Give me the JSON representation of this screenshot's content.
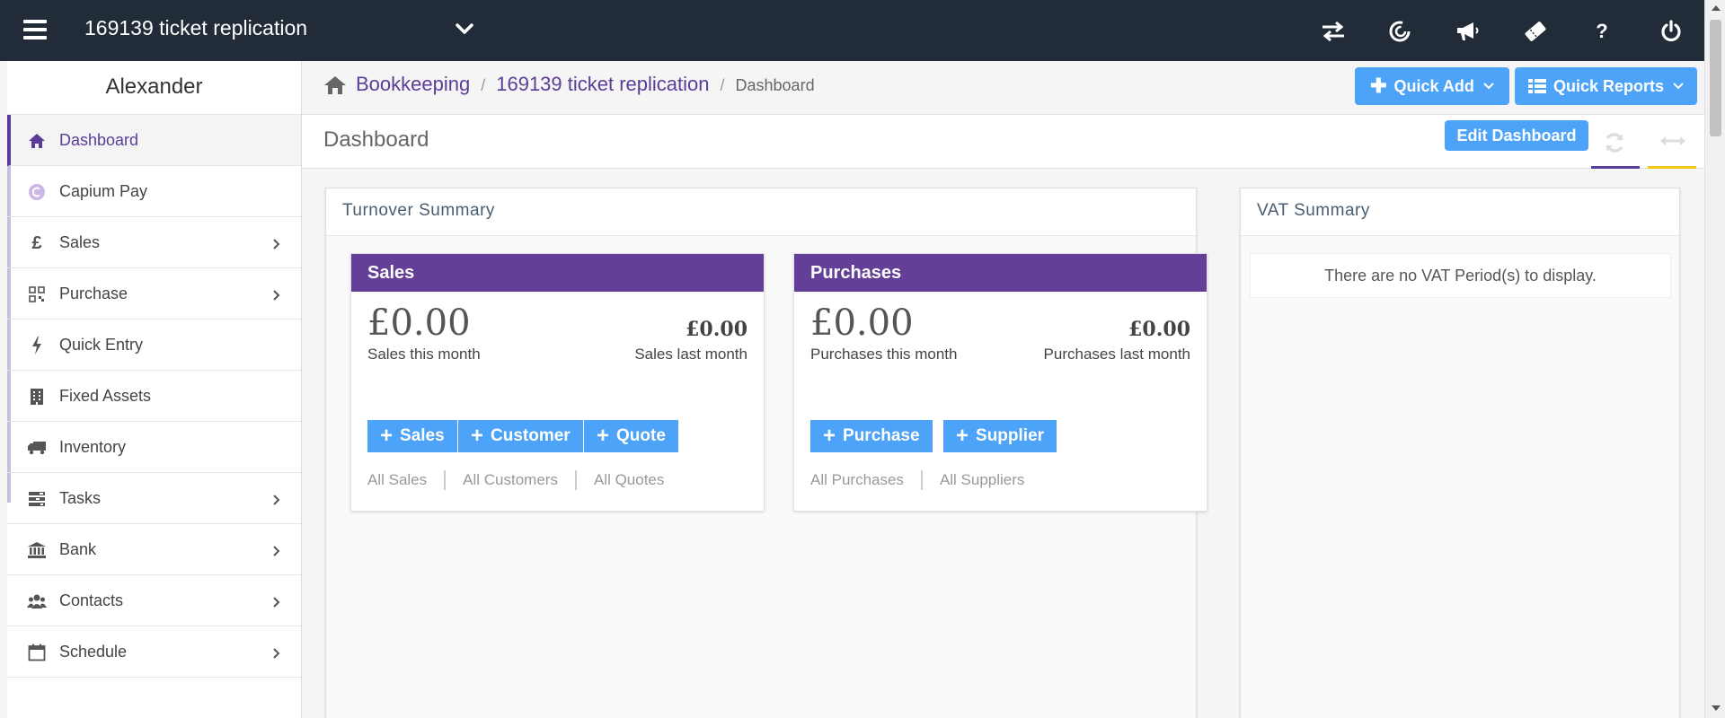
{
  "topbar": {
    "company": "169139 ticket replication",
    "icons": [
      "switch-arrows-icon",
      "capium-icon",
      "megaphone-icon",
      "ticket-icon",
      "help-icon",
      "power-icon"
    ]
  },
  "sidebar": {
    "user": "Alexander",
    "items": [
      {
        "label": "Dashboard",
        "icon": "home-icon",
        "arrow": false,
        "active": true
      },
      {
        "label": "Capium Pay",
        "icon": "capium-pay-icon",
        "arrow": false
      },
      {
        "label": "Sales",
        "icon": "pound-icon",
        "arrow": true
      },
      {
        "label": "Purchase",
        "icon": "qr-icon",
        "arrow": true
      },
      {
        "label": "Quick Entry",
        "icon": "bolt-icon",
        "arrow": false
      },
      {
        "label": "Fixed Assets",
        "icon": "building-icon",
        "arrow": false
      },
      {
        "label": "Inventory",
        "icon": "truck-icon",
        "arrow": false
      },
      {
        "label": "Tasks",
        "icon": "tasks-icon",
        "arrow": true
      },
      {
        "label": "Bank",
        "icon": "bank-icon",
        "arrow": true
      },
      {
        "label": "Contacts",
        "icon": "users-icon",
        "arrow": true
      },
      {
        "label": "Schedule",
        "icon": "calendar-icon",
        "arrow": true
      }
    ]
  },
  "breadcrumb": {
    "items": [
      "Bookkeeping",
      "169139 ticket replication"
    ],
    "current": "Dashboard"
  },
  "actions": {
    "quick_add": "Quick Add",
    "quick_reports": "Quick Reports",
    "edit_dashboard": "Edit Dashboard"
  },
  "page": {
    "title": "Dashboard"
  },
  "turnover": {
    "title": "Turnover Summary",
    "sales": {
      "title": "Sales",
      "this_month_amount": "£0.00",
      "this_month_label": "Sales this month",
      "last_month_amount": "£0.00",
      "last_month_label": "Sales last month",
      "buttons": [
        "Sales",
        "Customer",
        "Quote"
      ],
      "links": [
        "All Sales",
        "All Customers",
        "All Quotes"
      ]
    },
    "purchases": {
      "title": "Purchases",
      "this_month_amount": "£0.00",
      "this_month_label": "Purchases this month",
      "last_month_amount": "£0.00",
      "last_month_label": "Purchases last month",
      "buttons": [
        "Purchase",
        "Supplier"
      ],
      "links": [
        "All Purchases",
        "All Suppliers"
      ]
    }
  },
  "vat": {
    "title": "VAT Summary",
    "empty_message": "There are no VAT Period(s) to display."
  },
  "colors": {
    "topbar": "#222b38",
    "brand_purple": "#5b3d99",
    "card_header": "#643f98",
    "button_blue": "#4da3f7",
    "accent_yellow": "#f5c518"
  }
}
